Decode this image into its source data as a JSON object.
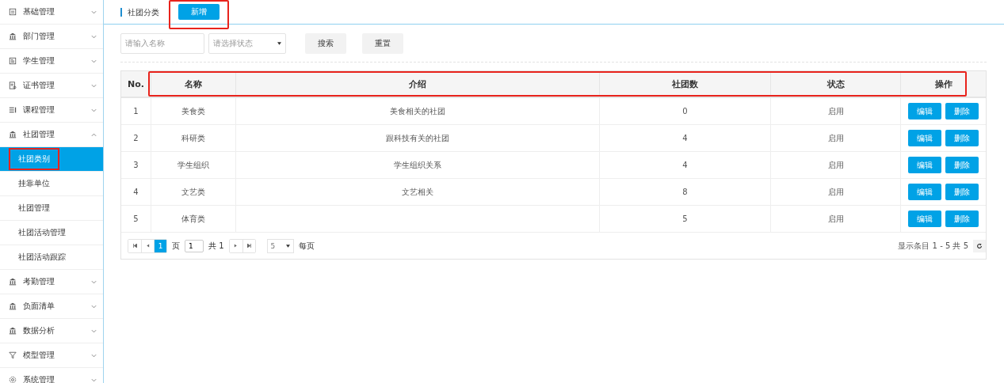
{
  "sidebar": {
    "items": [
      {
        "label": "基础管理",
        "expanded": false
      },
      {
        "label": "部门管理",
        "expanded": false
      },
      {
        "label": "学生管理",
        "expanded": false
      },
      {
        "label": "证书管理",
        "expanded": false
      },
      {
        "label": "课程管理",
        "expanded": false
      },
      {
        "label": "社团管理",
        "expanded": true,
        "children": [
          {
            "label": "社团类别",
            "selected": true,
            "highlighted": true
          },
          {
            "label": "挂靠单位",
            "selected": false,
            "highlighted": false
          },
          {
            "label": "社团管理",
            "selected": false,
            "highlighted": false
          },
          {
            "label": "社团活动管理",
            "selected": false,
            "highlighted": false
          },
          {
            "label": "社团活动跟踪",
            "selected": false,
            "highlighted": false
          }
        ]
      },
      {
        "label": "考勤管理",
        "expanded": false
      },
      {
        "label": "负面清单",
        "expanded": false
      },
      {
        "label": "数据分析",
        "expanded": false
      },
      {
        "label": "模型管理",
        "expanded": false
      },
      {
        "label": "系统管理",
        "expanded": false
      }
    ]
  },
  "header": {
    "title": "社团分类",
    "add_button": {
      "label": "新增",
      "highlighted": true
    }
  },
  "filters": {
    "name_placeholder": "请输入名称",
    "status_placeholder": "请选择状态",
    "search": "搜索",
    "reset": "重置"
  },
  "table": {
    "columns": [
      "No.",
      "名称",
      "介绍",
      "社团数",
      "状态",
      "操作"
    ],
    "header_highlighted": true,
    "rows": [
      {
        "no": "1",
        "name": "美食类",
        "intro": "美食相关的社团",
        "count": "0",
        "status": "启用",
        "edit": "编辑",
        "delete": "删除"
      },
      {
        "no": "2",
        "name": "科研类",
        "intro": "跟科技有关的社团",
        "count": "4",
        "status": "启用",
        "edit": "编辑",
        "delete": "删除"
      },
      {
        "no": "3",
        "name": "学生组织",
        "intro": "学生组织关系",
        "count": "4",
        "status": "启用",
        "edit": "编辑",
        "delete": "删除"
      },
      {
        "no": "4",
        "name": "文艺类",
        "intro": "文艺相关",
        "count": "8",
        "status": "启用",
        "edit": "编辑",
        "delete": "删除"
      },
      {
        "no": "5",
        "name": "体育类",
        "intro": "",
        "count": "5",
        "status": "启用",
        "edit": "编辑",
        "delete": "删除"
      }
    ]
  },
  "pagination": {
    "current_page": "1",
    "page_label": "页",
    "page_input": "1",
    "total_pages": "共 1",
    "page_size": "5",
    "per_page_label": "每页",
    "summary": "显示条目 1 - 5 共 5"
  }
}
